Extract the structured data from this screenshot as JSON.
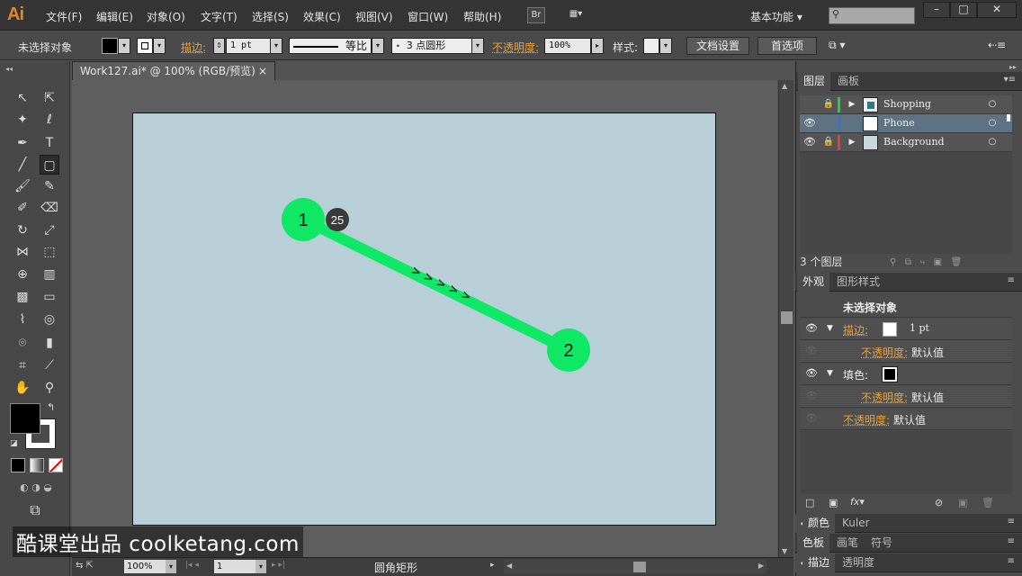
{
  "app": {
    "logo": "Ai"
  },
  "menu": {
    "items": [
      "文件(F)",
      "编辑(E)",
      "对象(O)",
      "文字(T)",
      "选择(S)",
      "效果(C)",
      "视图(V)",
      "窗口(W)",
      "帮助(H)"
    ],
    "bridge": "Br",
    "workspace": "基本功能"
  },
  "control_bar": {
    "selection": "未选择对象",
    "stroke_label": "描边:",
    "stroke_weight": "1 pt",
    "stroke_profile": "等比",
    "brush": "3 点圆形",
    "opacity_label": "不透明度:",
    "opacity_value": "100%",
    "style_label": "样式:",
    "doc_setup": "文档设置",
    "preferences": "首选项"
  },
  "document": {
    "tab_title": "Work127.ai* @ 100% (RGB/预览)",
    "close": "×",
    "zoom": "100%",
    "artboard_num": "1",
    "current_tool": "圆角矩形"
  },
  "annotations": {
    "start_marker": "1",
    "end_marker": "2",
    "badge": "25",
    "arrows": "> > > > >"
  },
  "layers_panel": {
    "tabs": [
      "图层",
      "画板"
    ],
    "layers": [
      {
        "name": "Shopping",
        "color": "#2ecc40"
      },
      {
        "name": "Phone",
        "color": "#3b6fd8"
      },
      {
        "name": "Background",
        "color": "#e04040"
      }
    ],
    "count": "3 个图层"
  },
  "appearance_panel": {
    "tabs": [
      "外观",
      "图形样式"
    ],
    "title": "未选择对象",
    "stroke_label": "描边:",
    "stroke_value": "1 pt",
    "stroke_opacity_label": "不透明度:",
    "stroke_opacity_value": "默认值",
    "fill_label": "填色:",
    "fill_opacity_label": "不透明度:",
    "fill_opacity_value": "默认值",
    "opacity_label": "不透明度:",
    "opacity_value": "默认值"
  },
  "collapsed_panels": {
    "row1": [
      "颜色",
      "Kuler"
    ],
    "row2": [
      "色板",
      "画笔",
      "符号"
    ],
    "row3": [
      "描边",
      "透明度"
    ]
  },
  "watermark": "酷课堂出品 coolketang.com",
  "colors": {
    "accent_green": "#0ee865",
    "artboard": "#b8cfd7"
  }
}
